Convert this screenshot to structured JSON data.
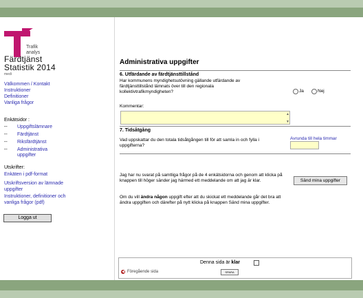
{
  "sidebar": {
    "logo_text": [
      "Trafik",
      "analys"
    ],
    "title_line1": "Färdtjänst",
    "title_line2": "Statistik 2014",
    "title_sub": "medi",
    "links": [
      "Välkommen / Kontakt",
      "Instruktioner",
      "Definitioner",
      "Vanliga frågor"
    ],
    "enkat_head": "Enkätsidor :",
    "enkat_items": [
      "Uppgiftslämnare",
      "Färdtjänst",
      "Riksfärdtjänst",
      "Administrativa uppgifter"
    ],
    "bullet": "--",
    "print_head": "Utskrifter:",
    "print_links": [
      "Enkäten i pdf-format",
      "Utskriftsversion av lämnade uppgifter",
      "Instruktioner, definitioner och vanliga frågor (pdf)"
    ],
    "logout_label": "Logga ut"
  },
  "main": {
    "page_title": "Administrativa uppgifter",
    "sec6_title": "6. Utfärdande av färdtjänsttillstånd",
    "sec6_question": "Har kommunens myndighetsutövning gällande utfärdande av färdtjänsttillstånd lämnats över till den regionala kollektivtrafikmyndigheten?",
    "radio_yes": "Ja",
    "radio_no": "Nej",
    "comment_label": "Kommentar:",
    "sec7_title": "7. Tidsåtgång",
    "sec7_question": "Vad uppskattar du den totala tidsåtgången till för att samla in och fylla i uppgifterna?",
    "round_note": "Avrunda till hela timmar",
    "submit_text": "Jag har nu svarat på samtliga frågor på de 4 enkätsidorna och genom att klicka på knappen till höger sänder jag härmed ett meddelande om att jag är klar.",
    "send_label": "Sänd mina uppgifter",
    "change_text_pre": "Om du vill ",
    "change_text_bold": "ändra någon",
    "change_text_post": " uppgift efter att du skickat ett meddelande går det bra att ändra uppgiften och därefter på nytt klicka på knappen Sänd mina uppgifter."
  },
  "footer": {
    "done_label": "Denna sida är ",
    "done_bold": "klar",
    "prev_label": "Föregående sida",
    "save_label": "SPARA"
  },
  "colors": {
    "bar_dark": "#8aa57e",
    "bar_light": "#b9cbb1",
    "link": "#2b2bb0",
    "logo": "#c0166f",
    "input_bg": "#ffffc8"
  }
}
